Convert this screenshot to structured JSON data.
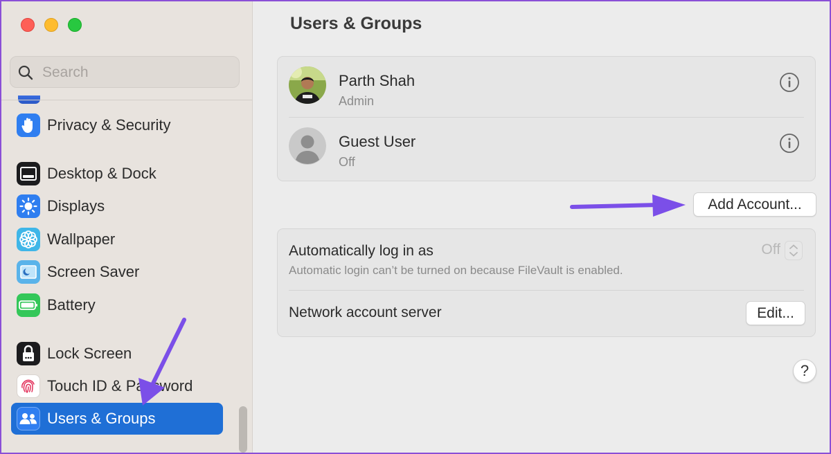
{
  "sidebar": {
    "search_placeholder": "Search",
    "items": [
      {
        "label": "Privacy & Security",
        "icon": "hand-icon"
      },
      {
        "label": "Desktop & Dock",
        "icon": "dock-icon"
      },
      {
        "label": "Displays",
        "icon": "sun-icon"
      },
      {
        "label": "Wallpaper",
        "icon": "flower-icon"
      },
      {
        "label": "Screen Saver",
        "icon": "screensaver-icon"
      },
      {
        "label": "Battery",
        "icon": "battery-icon"
      },
      {
        "label": "Lock Screen",
        "icon": "lock-icon"
      },
      {
        "label": "Touch ID & Password",
        "icon": "fingerprint-icon"
      },
      {
        "label": "Users & Groups",
        "icon": "users-icon",
        "selected": true
      }
    ]
  },
  "main": {
    "title": "Users & Groups",
    "users": [
      {
        "name": "Parth Shah",
        "role": "Admin"
      },
      {
        "name": "Guest User",
        "role": "Off"
      }
    ],
    "add_account_label": "Add Account...",
    "auto_login": {
      "title": "Automatically log in as",
      "subtitle": "Automatic login can’t be turned on because FileVault is enabled.",
      "value": "Off"
    },
    "network": {
      "title": "Network account server",
      "edit_label": "Edit..."
    },
    "help_label": "?"
  },
  "colors": {
    "accent": "#1f6fd6",
    "annotation_arrow": "#7b4fe8"
  }
}
